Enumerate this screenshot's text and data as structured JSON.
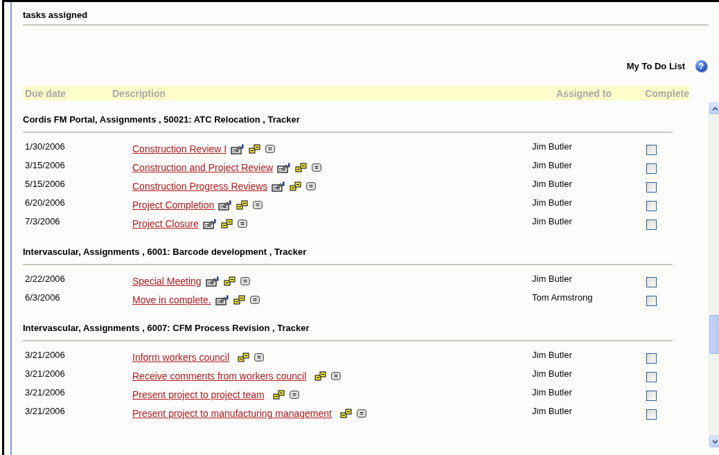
{
  "panel": {
    "title": "tasks assigned"
  },
  "list_title": "My To Do List",
  "help": "?",
  "columns": [
    "Due date",
    "Description",
    "Assigned to",
    "Complete"
  ],
  "groups": [
    {
      "title": "Cordis FM Portal, Assignments , 50021: ATC Relocation , Tracker",
      "tasks": [
        {
          "due": "1/30/2006",
          "description": "Construction Review I",
          "editable": true,
          "assigned_to": "Jim Butler",
          "complete": false
        },
        {
          "due": "3/15/2006",
          "description": "Construction and Project Review",
          "editable": true,
          "assigned_to": "Jim Butler",
          "complete": false
        },
        {
          "due": "5/15/2006",
          "description": "Construction Progress Reviews",
          "editable": true,
          "assigned_to": "Jim Butler",
          "complete": false
        },
        {
          "due": "6/20/2006",
          "description": "Project Completion",
          "editable": true,
          "assigned_to": "Jim Butler",
          "complete": false
        },
        {
          "due": "7/3/2006",
          "description": "Project Closure",
          "editable": true,
          "assigned_to": "Jim Butler",
          "complete": false
        }
      ]
    },
    {
      "title": "Intervascular, Assignments , 6001: Barcode development , Tracker",
      "tasks": [
        {
          "due": "2/22/2006",
          "description": "Special Meeting",
          "editable": true,
          "assigned_to": "Jim Butler",
          "complete": false
        },
        {
          "due": "6/3/2006",
          "description": "Move in complete.",
          "editable": true,
          "assigned_to": "Tom Armstrong",
          "complete": false
        }
      ]
    },
    {
      "title": "Intervascular, Assignments , 6007: CFM Process Revision , Tracker",
      "tasks": [
        {
          "due": "3/21/2006",
          "description": "Inform workers council",
          "editable": false,
          "assigned_to": "Jim Butler",
          "complete": false
        },
        {
          "due": "3/21/2006",
          "description": "Receive comments from workers council",
          "editable": false,
          "assigned_to": "Jim Butler",
          "complete": false
        },
        {
          "due": "3/21/2006",
          "description": "Present project to project team",
          "editable": false,
          "assigned_to": "Jim Butler",
          "complete": false
        },
        {
          "due": "3/21/2006",
          "description": "Present project to manufacturing management",
          "editable": false,
          "assigned_to": "Jim Butler",
          "complete": false
        }
      ]
    }
  ]
}
